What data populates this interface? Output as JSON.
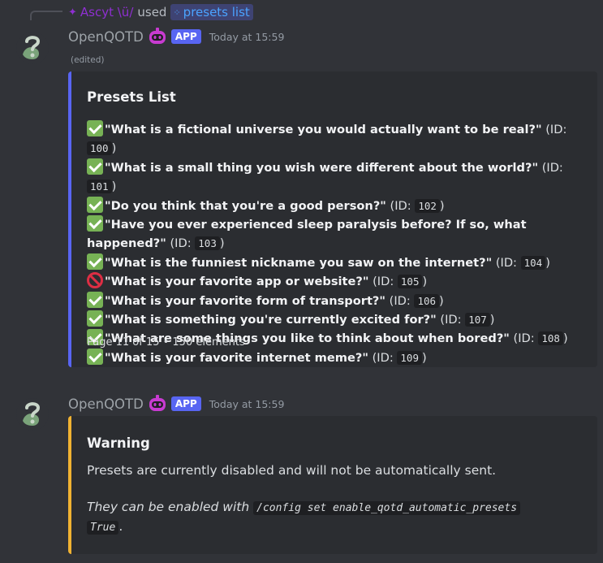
{
  "reply": {
    "user": "Ascyt \\ü/",
    "used": "used",
    "command": "presets list"
  },
  "messages": [
    {
      "author": "OpenQOTD",
      "app_tag": "APP",
      "timestamp": "Today at 15:59",
      "edited": "(edited)"
    },
    {
      "author": "OpenQOTD",
      "app_tag": "APP",
      "timestamp": "Today at 15:59"
    }
  ],
  "presets_embed": {
    "accent": "#5865f2",
    "title": "Presets List",
    "items": [
      {
        "status": "enabled",
        "question": "\"What is a fictional universe you would actually want to be real?\"",
        "id_label": " (ID: ",
        "id": "100",
        "close": ")"
      },
      {
        "status": "enabled",
        "question": "\"What is a small thing you wish were different about the world?\"",
        "id_label": " (ID: ",
        "id": "101",
        "close": ")"
      },
      {
        "status": "enabled",
        "question": "\"Do you think that you're a good person?\"",
        "id_label": " (ID: ",
        "id": "102",
        "close": ")"
      },
      {
        "status": "enabled",
        "question": "\"Have you ever experienced sleep paralysis before? If so, what happened?\"",
        "id_label": " (ID: ",
        "id": "103",
        "close": ")"
      },
      {
        "status": "enabled",
        "question": "\"What is the funniest nickname you saw on the internet?\"",
        "id_label": " (ID: ",
        "id": "104",
        "close": ")"
      },
      {
        "status": "disabled",
        "question": "\"What is your favorite app or website?\"",
        "id_label": " (ID: ",
        "id": "105",
        "close": ")"
      },
      {
        "status": "enabled",
        "question": "\"What is your favorite form of transport?\"",
        "id_label": " (ID: ",
        "id": "106",
        "close": ")"
      },
      {
        "status": "enabled",
        "question": "\"What is something you're currently excited for?\"",
        "id_label": " (ID: ",
        "id": "107",
        "close": ")"
      },
      {
        "status": "enabled",
        "question": "\"What are some things you like to think about when bored?\"",
        "id_label": " (ID: ",
        "id": "108",
        "close": ")"
      },
      {
        "status": "enabled",
        "question": "\"What is your favorite internet meme?\"",
        "id_label": " (ID: ",
        "id": "109",
        "close": ")"
      }
    ],
    "footer": "Page 11 of 15 • 150 elements"
  },
  "warning_embed": {
    "accent": "#f0b232",
    "title": "Warning",
    "text": "Presets are currently disabled and will not be automatically sent.",
    "hint_prefix": "They can be enabled with",
    "hint_code_line1": "/config set enable_qotd_automatic_presets",
    "hint_code_line2": "True",
    "hint_suffix": "."
  },
  "icons": {
    "avatar": "question-mark-leaf-icon",
    "bot": "robot-icon",
    "command": "slash-command-icon",
    "enabled": "check-mark-icon",
    "disabled": "prohibited-icon"
  }
}
